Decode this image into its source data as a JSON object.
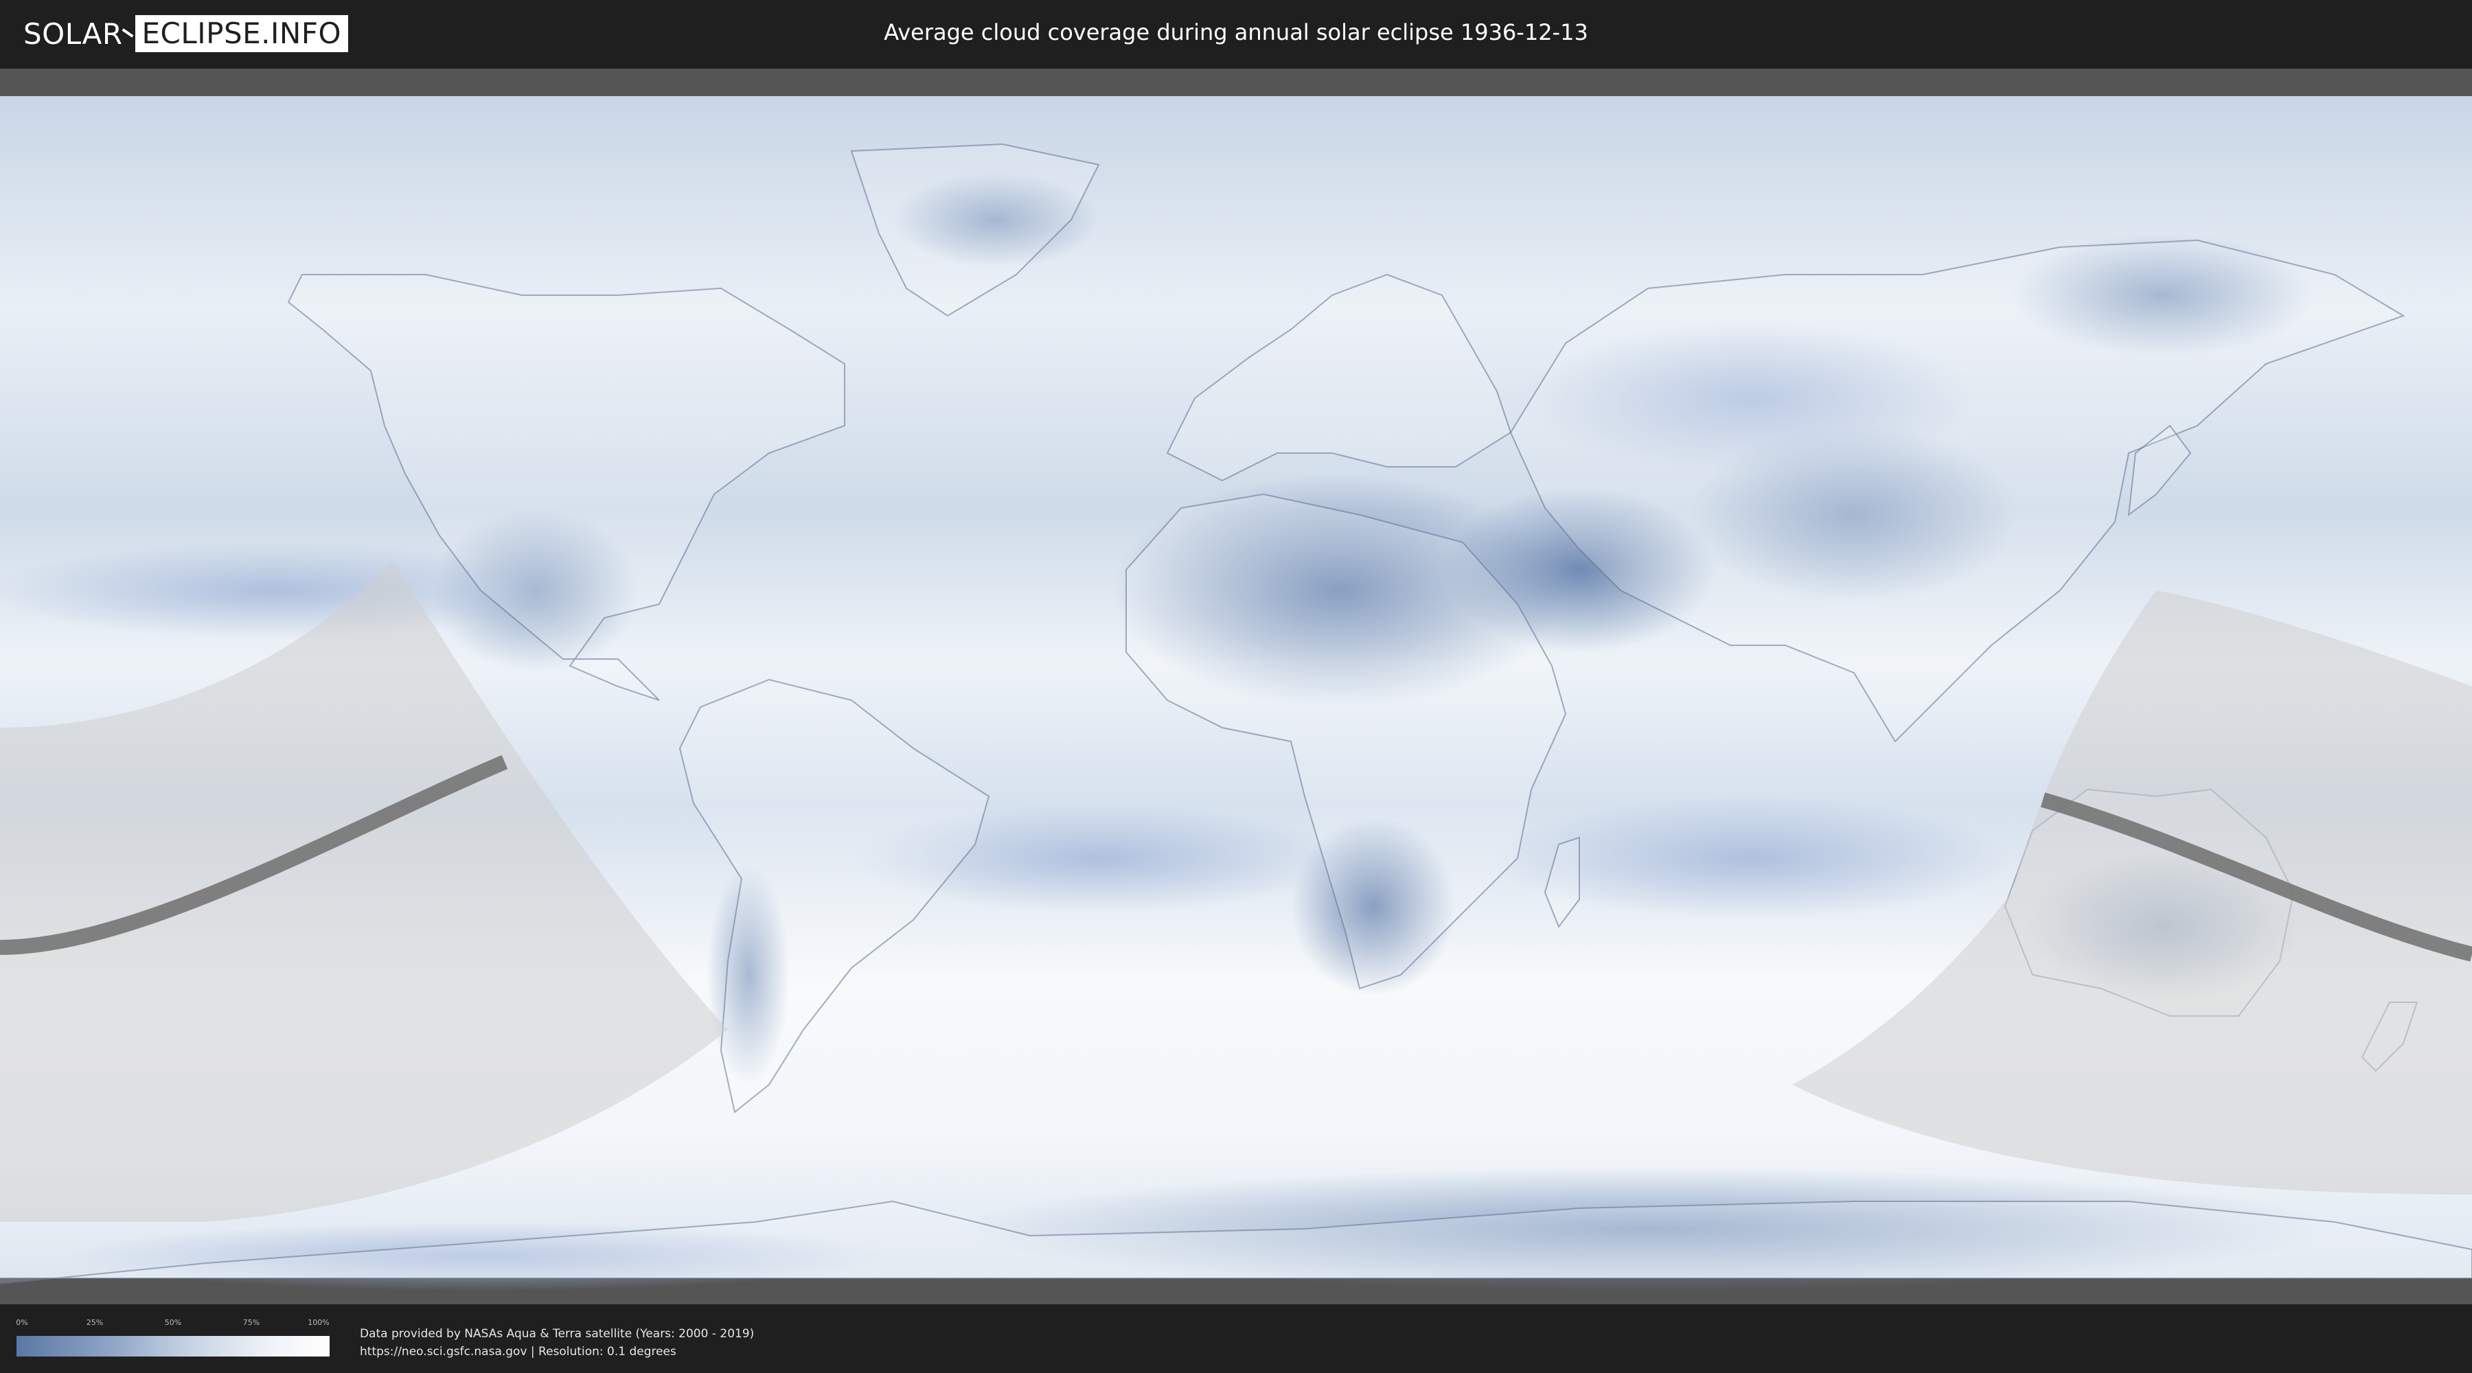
{
  "header": {
    "logo_left": "SOLAR",
    "logo_right": "ECLIPSE.INFO",
    "title": "Average cloud coverage during annual solar eclipse 1936-12-13"
  },
  "legend": {
    "ticks": [
      "0%",
      "25%",
      "50%",
      "75%",
      "100%"
    ],
    "colors": {
      "low": "#5b77a4",
      "high": "#ffffff"
    }
  },
  "credits": {
    "line1": "Data provided by NASAs Aqua & Terra satellite (Years: 2000 - 2019)",
    "line2": "https://neo.sci.gsfc.nasa.gov | Resolution: 0.1 degrees"
  },
  "map": {
    "colors": {
      "cloud_dense": "#f5f8fb",
      "cloud_sparse": "#6a86b1",
      "eclipse_zone": "#d2d2d2",
      "central_path": "#6f6f6f"
    }
  }
}
